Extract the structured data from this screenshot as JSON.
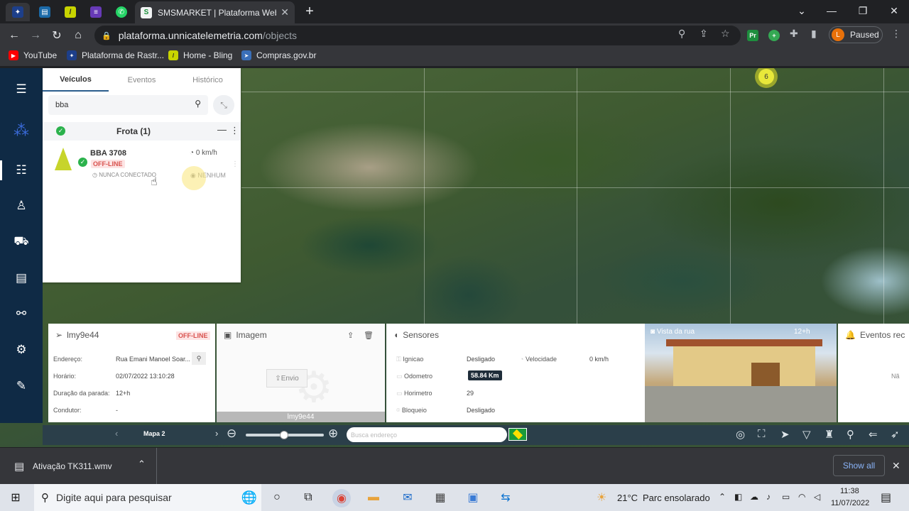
{
  "browser": {
    "active_tab_title": "SMSMARKET | Plataforma Web | ",
    "url_host": "plataforma.unnicatelemetria.com",
    "url_path": "/objects",
    "profile_initial": "L",
    "profile_status": "Paused",
    "bookmarks": [
      {
        "label": "YouTube",
        "color": "#ff0000"
      },
      {
        "label": "Plataforma de Rastr...",
        "color": "#1d3f8a"
      },
      {
        "label": "Home - Bling",
        "color": "#c8d400"
      },
      {
        "label": "Compras.gov.br",
        "color": "#3a6fb8"
      }
    ]
  },
  "vehicles_panel": {
    "tabs": [
      "Veículos",
      "Eventos",
      "Histórico"
    ],
    "search_value": "bba",
    "fleet_label": "Frota (1)",
    "vehicle": {
      "name": "BBA 3708",
      "status": "OFF-LINE",
      "speed": "0 km/h",
      "connection": "NUNCA CONECTADO",
      "event": "NENHUM"
    }
  },
  "map": {
    "cluster_count": "6"
  },
  "info_card": {
    "id": "lmy9e44",
    "status": "OFF-LINE",
    "rows": [
      {
        "key": "Endereço:",
        "value": "Rua Emani Manoel Soar..."
      },
      {
        "key": "Horário:",
        "value": "02/07/2022 13:10:28"
      },
      {
        "key": "Duração da parada:",
        "value": "12+h"
      },
      {
        "key": "Condutor:",
        "value": "-"
      }
    ]
  },
  "image_card": {
    "title": "Imagem",
    "send_label": "Envio",
    "caption": "lmy9e44"
  },
  "sensors_card": {
    "title": "Sensores",
    "ignition_label": "Ignicao",
    "ignition_value": "Desligado",
    "speed_label": "Velocidade",
    "speed_value": "0 km/h",
    "odometer_label": "Odometro",
    "odometer_value": "58.84 Km",
    "hourmeter_label": "Horimetro",
    "hourmeter_value": "29",
    "lock_label": "Bloqueio",
    "lock_value": "Desligado"
  },
  "street_view": {
    "title": "Vista da rua",
    "age": "12+h"
  },
  "events_card": {
    "title": "Eventos rec",
    "partial": "Nã"
  },
  "bottom_toolbar": {
    "map_label": "Mapa 2",
    "address_placeholder": "Busca endereço"
  },
  "download": {
    "file_name": "Ativação TK311.wmv",
    "show_all": "Show all"
  },
  "taskbar": {
    "search_placeholder": "Digite aqui para pesquisar",
    "temperature": "21°C",
    "weather": "Parc ensolarado",
    "time": "11:38",
    "date": "11/07/2022"
  },
  "colors": {
    "nav_bg": "#0f2a45",
    "offline_red": "#d9534f",
    "ok_green": "#2bb24c"
  }
}
